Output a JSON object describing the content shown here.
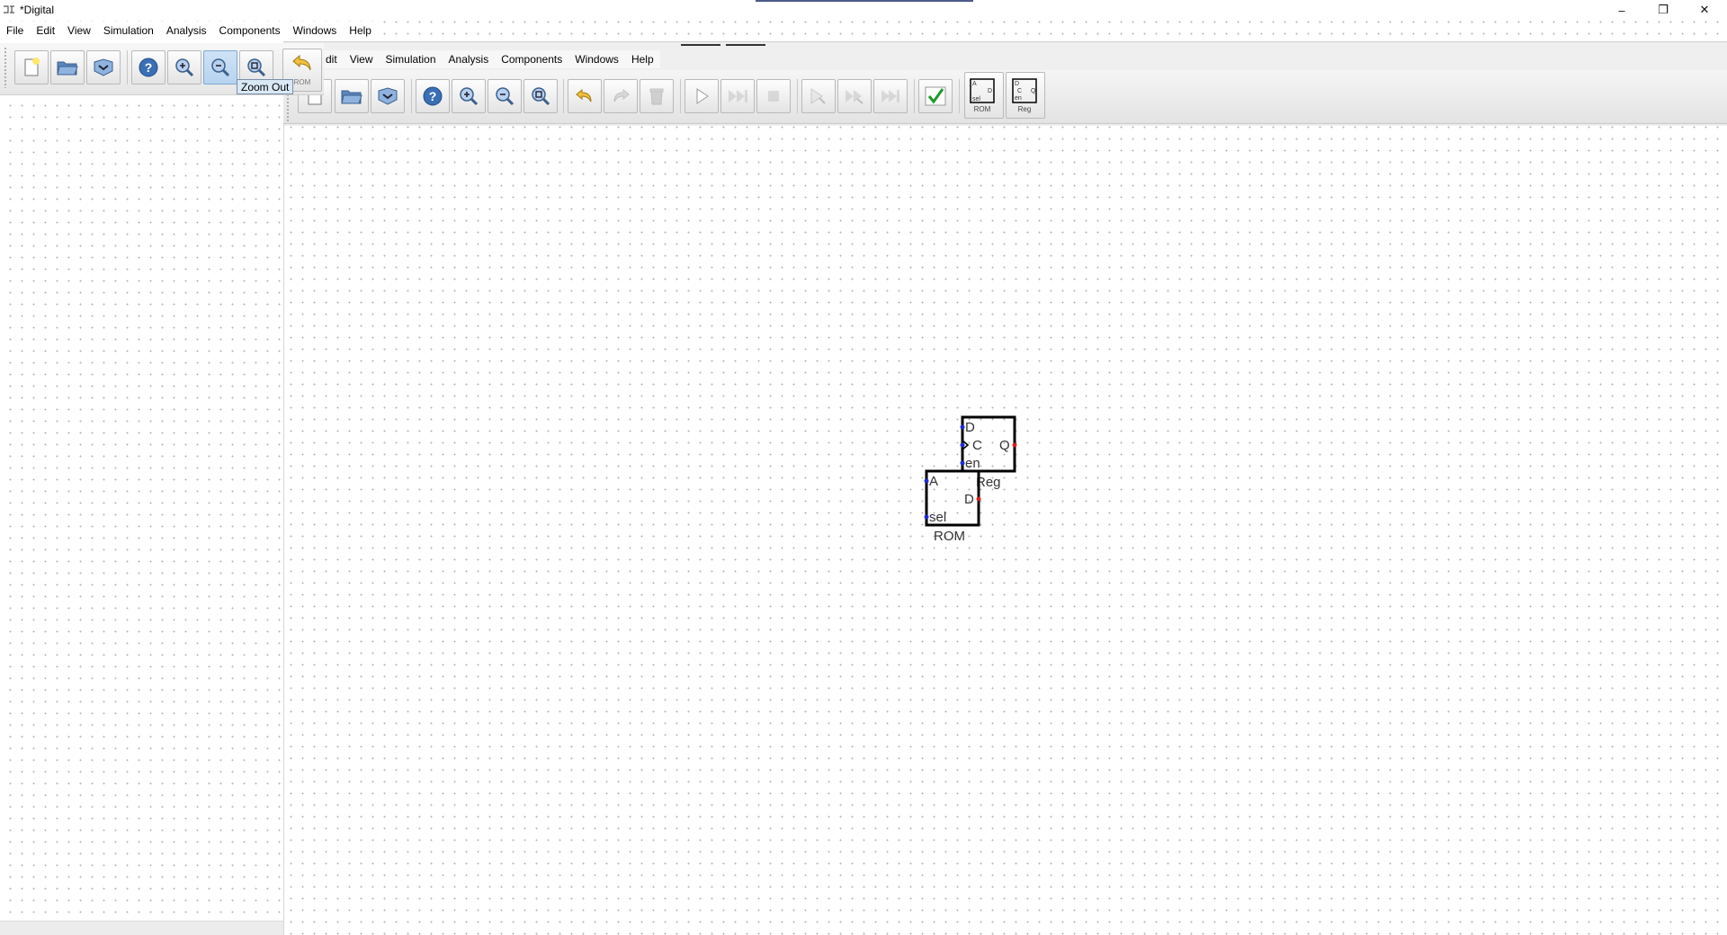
{
  "window": {
    "title": "*Digital",
    "controls": {
      "minimize": "–",
      "maximize": "❐",
      "close": "✕"
    }
  },
  "menu": [
    "File",
    "Edit",
    "View",
    "Simulation",
    "Analysis",
    "Components",
    "Windows",
    "Help"
  ],
  "floating_menu": [
    "dit",
    "View",
    "Simulation",
    "Analysis",
    "Components",
    "Windows",
    "Help"
  ],
  "toolbar_main": {
    "buttons": [
      "new-file",
      "open-file",
      "save-file",
      "help",
      "zoom-in",
      "zoom-out",
      "zoom-fit",
      "undo"
    ],
    "pressed": "zoom-out",
    "partial_label": "ROM"
  },
  "tooltip": {
    "text": "Zoom Out"
  },
  "toolbar_floating": {
    "buttons": [
      "new-file",
      "open-file",
      "save-file",
      "help",
      "zoom-in",
      "zoom-out",
      "zoom-fit",
      "undo",
      "redo",
      "delete",
      "start-simulation",
      "fast-run",
      "stop-simulation",
      "step",
      "step-fast",
      "step-end",
      "check"
    ],
    "disabled": [
      "redo",
      "delete",
      "fast-run",
      "stop-simulation",
      "step",
      "step-fast",
      "step-end"
    ],
    "component_previews": [
      {
        "label": "ROM",
        "pins": [
          "A",
          "D",
          "sel"
        ]
      },
      {
        "label": "Reg",
        "pins": [
          "D",
          "C",
          "en",
          "Q"
        ]
      }
    ]
  },
  "circuit": {
    "components": [
      {
        "type": "Reg",
        "label": "Reg",
        "pins_in": [
          "D",
          "C",
          "en"
        ],
        "pins_out": [
          "Q"
        ]
      },
      {
        "type": "ROM",
        "label": "ROM",
        "pins_in": [
          "A",
          "sel"
        ],
        "pins_out": [
          "D"
        ]
      }
    ]
  },
  "colors": {
    "grid_dot": "#b4b4b4",
    "input_pin": "#1b2bd6",
    "output_pin": "#d62020",
    "component_border": "#000000",
    "tooltip_bg": "#d9e8f5"
  }
}
